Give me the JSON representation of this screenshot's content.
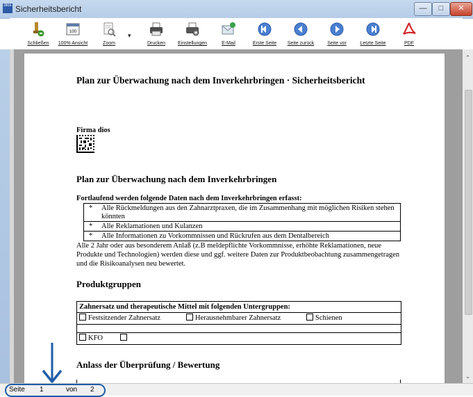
{
  "window": {
    "title": "Sicherheitsbericht",
    "app_icon": "dios",
    "buttons": {
      "minimize": "—",
      "maximize": "□",
      "close": "✕"
    }
  },
  "toolbar": {
    "items": [
      {
        "label": "Schließen",
        "icon": "close-app-icon"
      },
      {
        "label": "100% Ansicht",
        "icon": "100",
        "icon_name": "zoom-100-icon"
      },
      {
        "label": "Zoom",
        "icon": "zoom-icon"
      },
      {
        "label": "Drucken",
        "icon": "printer-icon"
      },
      {
        "label": "Einstellungen",
        "icon": "printer-settings-icon"
      },
      {
        "label": "E-Mail",
        "icon": "email-icon"
      },
      {
        "label": "Erste Seite",
        "icon": "first-page-icon"
      },
      {
        "label": "Seite zurück",
        "icon": "previous-page-icon"
      },
      {
        "label": "Seite vor",
        "icon": "next-page-icon"
      },
      {
        "label": "Letzte Seite",
        "icon": "last-page-icon"
      },
      {
        "label": "PDF",
        "icon": "pdf-icon"
      }
    ],
    "zoom_dropdown": "▾"
  },
  "document": {
    "title": "Plan zur Überwachung nach dem Inverkehrbringen · Sicherheitsbericht",
    "company": "Firma dios",
    "section_plan": {
      "heading": "Plan zur Überwachung nach dem Inverkehrbringen",
      "lead": "Fortlaufend werden folgende Daten nach dem Inverkehrbringen erfasst:",
      "bullets": [
        "Alle Rückmeldungen aus den Zahnarztpraxen, die im Zusammenhang mit möglichen Risiken stehen könnten",
        "Alle Reklamationen und Kulanzen",
        "Alle Informationen zu Vorkommnissen und Rückrufen aus dem Dentalbereich"
      ],
      "bullet_marker": "*",
      "paragraph": "Alle 2 Jahr oder aus besonderem Anlaß (z.B meldepflichte Vorkommnisse, erhöhte Reklamationen, neue Produkte und Technologien) werden diese und ggf. weitere Daten zur Produktbeobachtung zusammengetragen und die Risikoanalysen neu bewertet."
    },
    "section_groups": {
      "heading": "Produktgruppen",
      "table_header": "Zahnersatz und therapeutische Mittel mit folgenden Untergruppen:",
      "row1": [
        "Festsitzender Zahnersatz",
        "Herausnehmbarer Zahnersatz",
        "Schienen"
      ],
      "row2": [
        "KFO",
        ""
      ]
    },
    "section_review": {
      "heading": "Anlass der Überprüfung / Bewertung"
    }
  },
  "statusbar": {
    "page_label": "Seite",
    "page_current": "1",
    "of_label": "von",
    "page_total": "2"
  },
  "colors": {
    "titlebar": "#c6d9ef",
    "viewer_background": "#9e9e9e",
    "annotation_blue": "#1e5ea8"
  }
}
